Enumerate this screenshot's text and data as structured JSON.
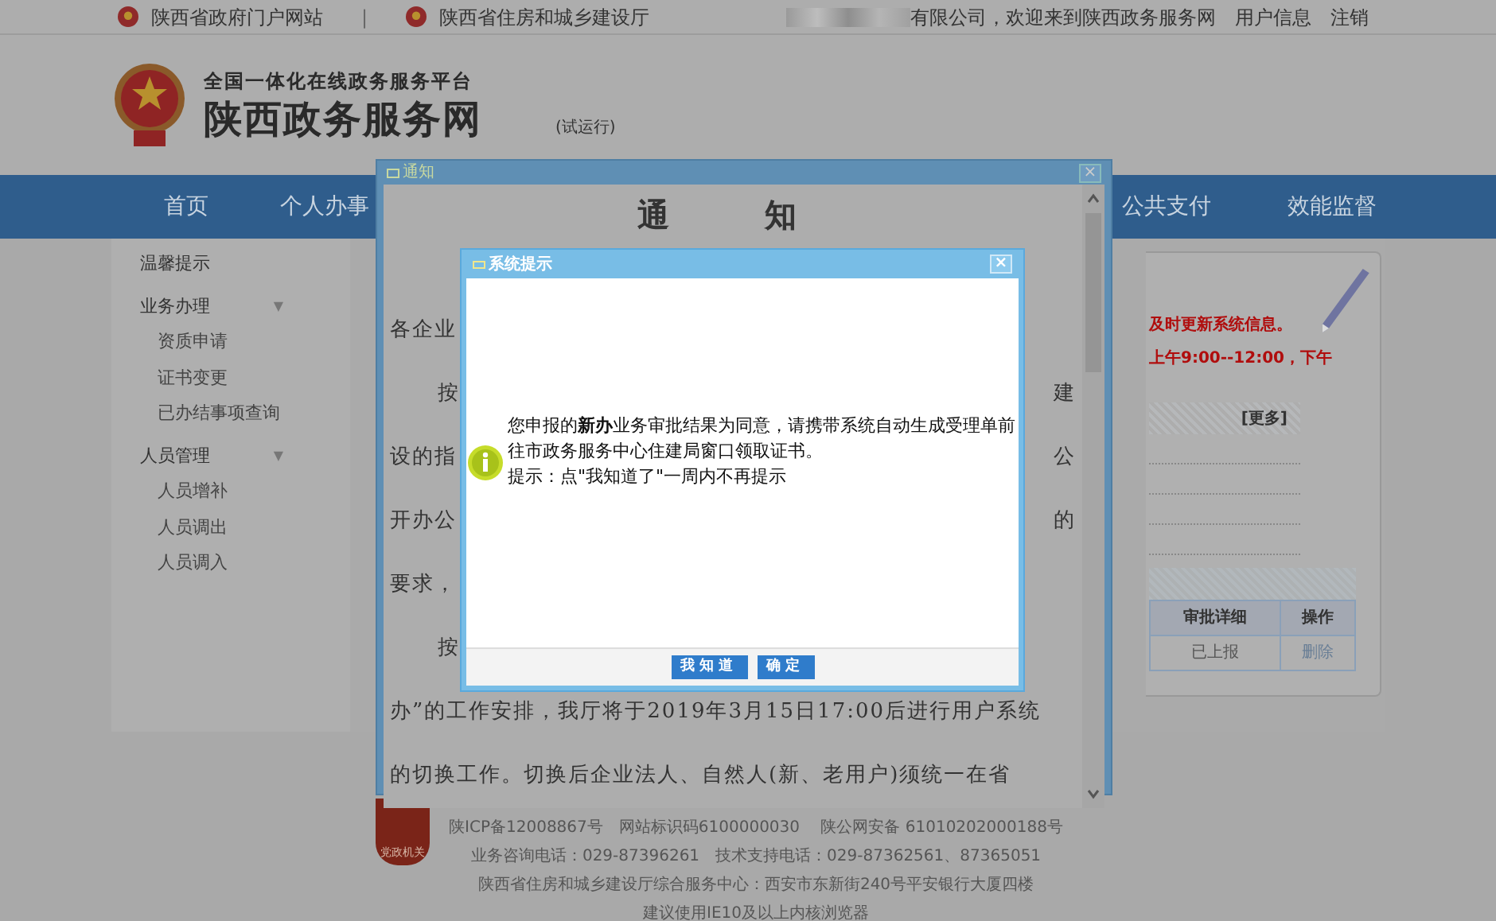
{
  "top_bar": {
    "links": [
      "陕西省政府门户网站",
      "陕西省住房和城乡建设厅"
    ],
    "separator": "|",
    "welcome": "有限公司，欢迎来到陕西政务服务网",
    "user_links": [
      "用户信息",
      "注销"
    ]
  },
  "header": {
    "subtitle": "全国一体化在线政务服务平台",
    "title": "陕西政务服务网",
    "badge": "(试运行)"
  },
  "nav": {
    "left": [
      "首页",
      "个人办事"
    ],
    "right": [
      "公共支付",
      "效能监督"
    ]
  },
  "sidebar": {
    "groups": [
      {
        "label": "温馨提示"
      },
      {
        "label": "业务办理",
        "caret": "▼",
        "children": [
          {
            "label": "资质申请"
          },
          {
            "label": "证书变更"
          },
          {
            "label": "已办结事项查询"
          }
        ]
      },
      {
        "label": "人员管理",
        "caret": "▼",
        "children": [
          {
            "label": "人员增补"
          },
          {
            "label": "人员调出"
          },
          {
            "label": "人员调入"
          }
        ]
      }
    ]
  },
  "panel": {
    "notices": [
      "及时更新系统信息。",
      "上午9:00--12:00，下午"
    ],
    "more": "[更多]",
    "table": {
      "columns": [
        "审批详细",
        "操作"
      ],
      "rows": [
        [
          "已上报",
          "删除"
        ]
      ]
    }
  },
  "footer": {
    "badge_text": "党政机关",
    "lines": [
      "陕ICP备12008867号　网站标识码6100000030　 陕公网安备 61010202000188号",
      "业务咨询电话：029-87396261　技术支持电话：029-87362561、87365051",
      "陕西省住房和城乡建设厅综合服务中心：西安市东新街240号平安银行大厦四楼",
      "建议使用IE10及以上内核浏览器"
    ]
  },
  "notice_window": {
    "title": "通知",
    "close": "×",
    "heading": "通　知",
    "rows": [
      {
        "left": "各企业"
      },
      {
        "left": "按",
        "right": "建",
        "indent": true
      },
      {
        "left": "设的指",
        "right": "公"
      },
      {
        "left": "开办公",
        "right": "的"
      },
      {
        "left": "要求，"
      },
      {
        "left": "按",
        "indent": true
      },
      {
        "left": "办”的工作安排，我厅将于2019年3月15日17:00后进行用户系统"
      },
      {
        "left": "的切换工作。切换后企业法人、自然人(新、老用户)须统一在省"
      }
    ]
  },
  "dialog": {
    "title": "系统提示",
    "close": "×",
    "message": "您申报的**新办**业务审批结果为同意，请携带系统自动生成受理单前往市政务服务中心住建局窗口领取证书。",
    "hint": "提示：点\"我知道了\"一周内不再提示",
    "buttons": [
      "我知道",
      "确定"
    ]
  }
}
